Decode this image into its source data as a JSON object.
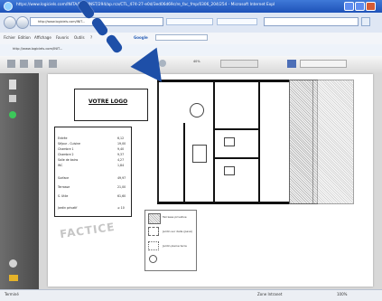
{
  "window": {
    "title": "https://www.logiciels.com/INITA/RAM/INST/294/ap.rca/CTL_474-27-e0d/3ed06d69c/re_fac_fmp/0306_204/254 - Microsoft Internet Expl"
  },
  "menubar": {
    "items": [
      "Fichier",
      "Edition",
      "Affichage",
      "Favoris",
      "Outils",
      "?"
    ],
    "google_label": "Google"
  },
  "address": {
    "value": "http://www.logiciels.com/INIT..."
  },
  "linkbar": {
    "label": "http://www.logiciels.com/INIT..."
  },
  "pdf_toolbar": {
    "zoom": "40%"
  },
  "document": {
    "logo_text": "VOTRE LOGO",
    "watermark": "FACTICE",
    "table_rows": [
      {
        "label": "Entrée",
        "value": "6,12"
      },
      {
        "label": "Séjour - Cuisine",
        "value": "19,00"
      },
      {
        "label": "Chambre 1",
        "value": "9,40"
      },
      {
        "label": "Chambre 2",
        "value": "9,37"
      },
      {
        "label": "Salle de bains",
        "value": "4,27"
      },
      {
        "label": "WC",
        "value": "1,84"
      },
      {
        "label": "Surface",
        "value": "49,97"
      },
      {
        "label": "Terrasse",
        "value": "21,00"
      },
      {
        "label": "S. Utile",
        "value": "61,60"
      },
      {
        "label": "Jardin privatif",
        "value": "≥ 10"
      }
    ],
    "legend": [
      "Terrasse privative",
      "Jardin sur dalle (pavé)",
      "Jardin pleine terre"
    ]
  },
  "statusbar": {
    "left": "Terminé",
    "middle": "Zone Intranet",
    "right": "100%"
  },
  "colors": {
    "titlebar": "#1e52b8",
    "arrow": "#1e4fa8",
    "page": "#ffffff"
  }
}
